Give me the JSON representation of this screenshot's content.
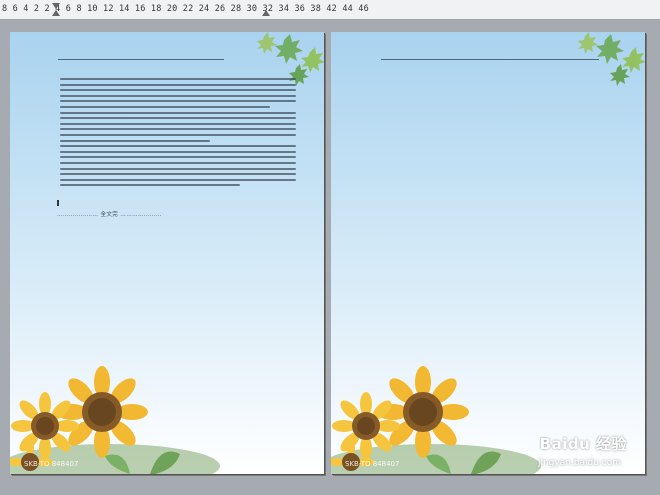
{
  "ruler": {
    "ticks": "8  6  4  2    2  4  6  8 10 12 14 16 18 20 22 24 26 28 30 32 34 36 38   42 44 46"
  },
  "pages": [
    {
      "watermark": "SKB-TO 848407",
      "footer_link": "………………… 全文完 …………………"
    },
    {
      "watermark": "SKB-TO 848407"
    }
  ],
  "brand": {
    "name": "Baidu 经验",
    "url": "jingyan.baidu.com"
  },
  "colors": {
    "sky_top": "#a9d3ef",
    "sky_bottom": "#ffffff"
  }
}
